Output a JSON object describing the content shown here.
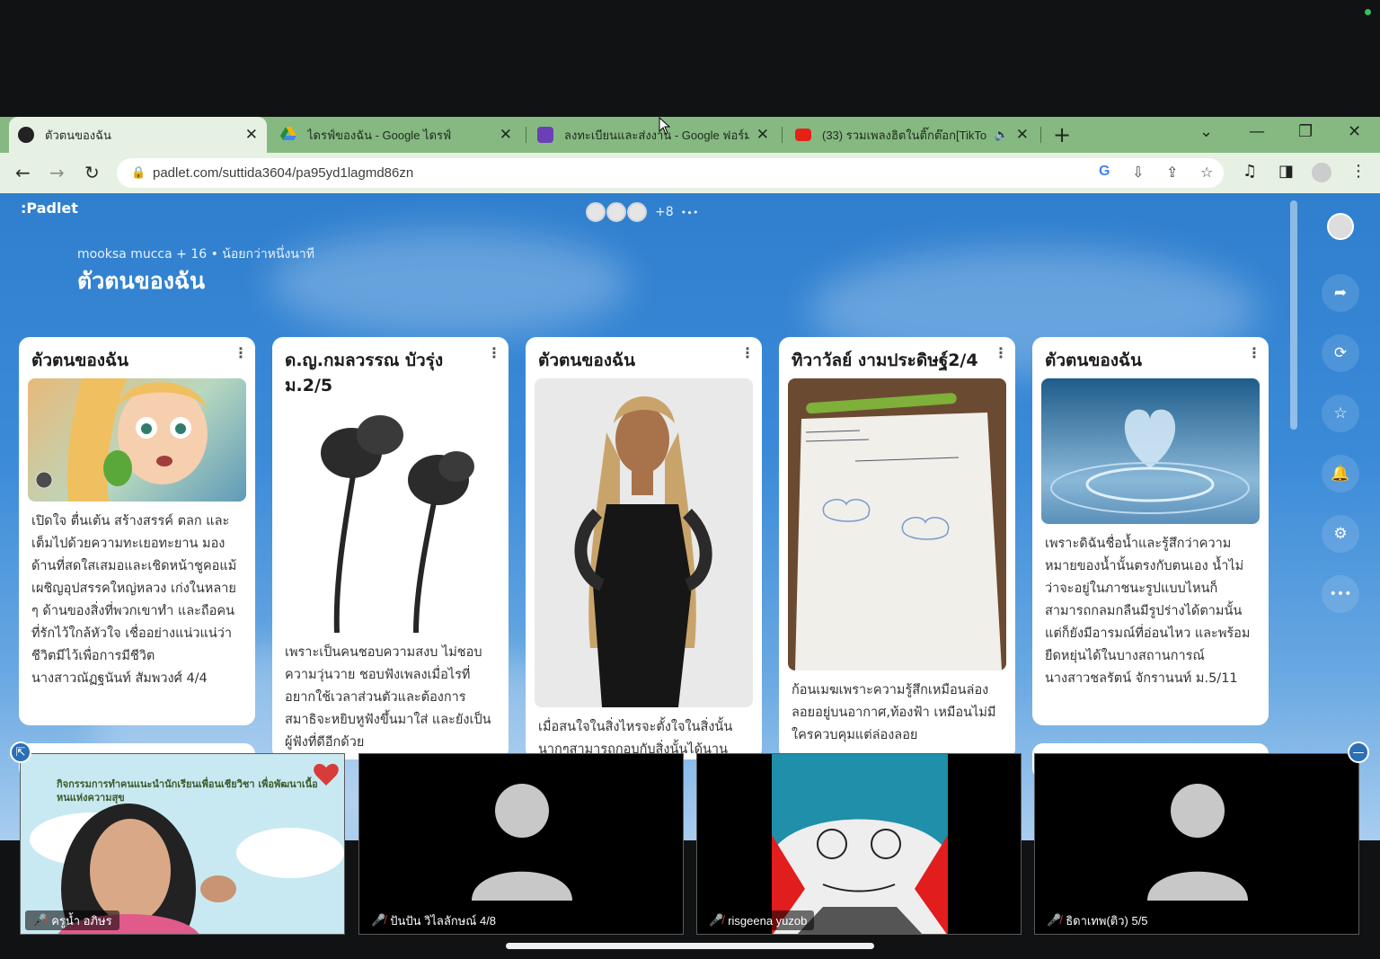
{
  "browser": {
    "tabs": [
      {
        "title": "ตัวตนของฉัน",
        "close": "✕"
      },
      {
        "title": "ไดรฟ์ของฉัน - Google ไดรฟ์",
        "close": "✕"
      },
      {
        "title": "ลงทะเบียนและส่งงาน - Google ฟอร์ม",
        "close": "✕"
      },
      {
        "title": "(33) รวมเพลงฮิตในติ๊กต๊อก[TikTo",
        "audio": "🔈",
        "close": "✕"
      }
    ],
    "newtab": "+",
    "url": "padlet.com/suttida3604/pa95yd1lagmd86zn"
  },
  "padlet": {
    "logo": ":Padlet",
    "collab_more": "+8",
    "author": "mooksa mucca",
    "author_more": "+ 16",
    "updated": "• น้อยกว่าหนึ่งนาที",
    "title": "ตัวตนของฉัน",
    "cards": [
      {
        "title": "ตัวตนของฉัน",
        "body": "เปิดใจ ตื่นเต้น สร้างสรรค์ ตลก และเต็มไปด้วยความทะเยอทะยาน มองด้านที่สดใสเสมอและเชิดหน้าชูคอแม้เผชิญอุปสรรคใหญ่หลวง เก่งในหลาย ๆ ด้านของสิ่งที่พวกเขาทำ และถือคนที่รักไว้ใกล้หัวใจ เชื่ออย่างแน่วแน่ว่าชีวิตมีไว้เพื่อการมีชีวิต",
        "author": "นางสาวณัฏฐนันท์ สัมพวงศ์ 4/4"
      },
      {
        "title": "ด.ญ.กมลวรรณ บัวรุ่ง ม.2/5",
        "body": "เพราะเป็นคนชอบความสงบ ไม่ชอบความวุ่นวาย ชอบฟังเพลงเมื่อไรที่อยากใช้เวลาส่วนตัวและต้องการสมาธิจะหยิบหูฟังขึ้นมาใส่ และยังเป็นผู้ฟังที่ดีอีกด้วย"
      },
      {
        "title": "ตัวตนของฉัน",
        "body": "เมื่อสนใจในสิ่งไหรจะตั้งใจในสิ่งนั้นนากๆสามารถกอบกับสิ่งนั้นได้นาน"
      },
      {
        "title": "ทิวาวัลย์ งามประดิษฐ์2/4",
        "body": "ก้อนเมฆเพราะความรู้สึกเหมือนล่องลอยอยู่บนอากาศ,ท้องฟ้า เหมือนไม่มีใครควบคุมแต่ล่องลอย"
      },
      {
        "title": "ตัวตนของฉัน",
        "body": "เพราะดิฉันชื่อน้ำและรู้สึกว่าความหมายของน้ำนั้นตรงกับตนเอง น้ำไม่ว่าจะอยู่ในภาชนะรูปแบบไหนก็สามารถกลมกลืนมีรูปร่างได้ตามนั้น แต่ก็ยังมีอารมณ์ที่อ่อนไหว และพร้อมยืดหยุ่นได้ในบางสถานการณ์",
        "author": "นางสาวชลรัตน์ จักรานนท์ ม.5/11"
      }
    ],
    "card_menu": "⋮",
    "rail_more": "•••"
  },
  "meeting": {
    "participants": [
      {
        "name": "ครูน้ำ อภิษร",
        "banner": "กิจกรรมการทำคนแนะนำนักเรียนเพื่อนเชียวิชา เพื่อพัฒนาเนื้อหนแห่งความสุข"
      },
      {
        "name": "ปันปัน วิไลลักษณ์ 4/8"
      },
      {
        "name": "risgeena yuzob"
      },
      {
        "name": "ธิดาเทพ(ติว) 5/5"
      }
    ]
  }
}
